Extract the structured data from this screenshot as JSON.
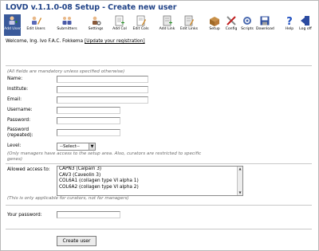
{
  "app": {
    "title": "LOVD v.1.1.0-08 Setup - Create new user"
  },
  "toolbar": [
    {
      "label": "Add User",
      "icon": "add-user-icon",
      "active": true
    },
    {
      "label": "Edit Users",
      "icon": "edit-users-icon"
    },
    {
      "label": "Submitters",
      "icon": "submitters-icon"
    },
    {
      "label": "Settings",
      "icon": "settings-icon"
    },
    {
      "label": "Add Col",
      "icon": "add-column-icon"
    },
    {
      "label": "Edit Cols",
      "icon": "edit-columns-icon"
    },
    {
      "label": "Add Link",
      "icon": "add-link-icon"
    },
    {
      "label": "Edit Links",
      "icon": "edit-links-icon"
    },
    {
      "label": "Setup",
      "icon": "setup-icon"
    },
    {
      "label": "Config",
      "icon": "config-icon"
    },
    {
      "label": "Scripts",
      "icon": "scripts-icon"
    },
    {
      "label": "Download",
      "icon": "download-icon"
    },
    {
      "label": "Help",
      "icon": "help-icon"
    },
    {
      "label": "Log off",
      "icon": "log-off-icon"
    }
  ],
  "welcome": {
    "text": "Welcome, Ing. Ivo F.A.C. Fokkema ",
    "link": "[Update your registration]"
  },
  "form": {
    "note_mandatory": "(All fields are mandatory unless specified otherwise)",
    "fields": {
      "name": {
        "label": "Name:"
      },
      "institute": {
        "label": "Institute:"
      },
      "email": {
        "label": "Email:"
      },
      "username": {
        "label": "Username:"
      },
      "password": {
        "label": "Password:"
      },
      "password_repeated": {
        "label_line1": "Password",
        "label_line2": "(repeated):"
      },
      "level": {
        "label": "Level:",
        "value": "--Select--"
      }
    },
    "note_managers_line1": "(Only managers have access to the setup area. Also, curators are restricted to specific",
    "note_managers_line2": "genes)",
    "allowed_access": {
      "label": "Allowed access to:",
      "options": [
        "CAPN3 (Calpain 3)",
        "CAV3 (Caveolin 3)",
        "COL6A1 (collagen type VI alpha 1)",
        "COL6A2 (collagen type VI alpha 2)"
      ]
    },
    "note_curators": "(This is only applicable for curators, not for managers)",
    "your_password": {
      "label": "Your password:"
    },
    "submit_label": "Create user"
  },
  "colors": {
    "title": "#224488",
    "active_tab": "#3a5a9a",
    "note": "#6a6a6a"
  }
}
